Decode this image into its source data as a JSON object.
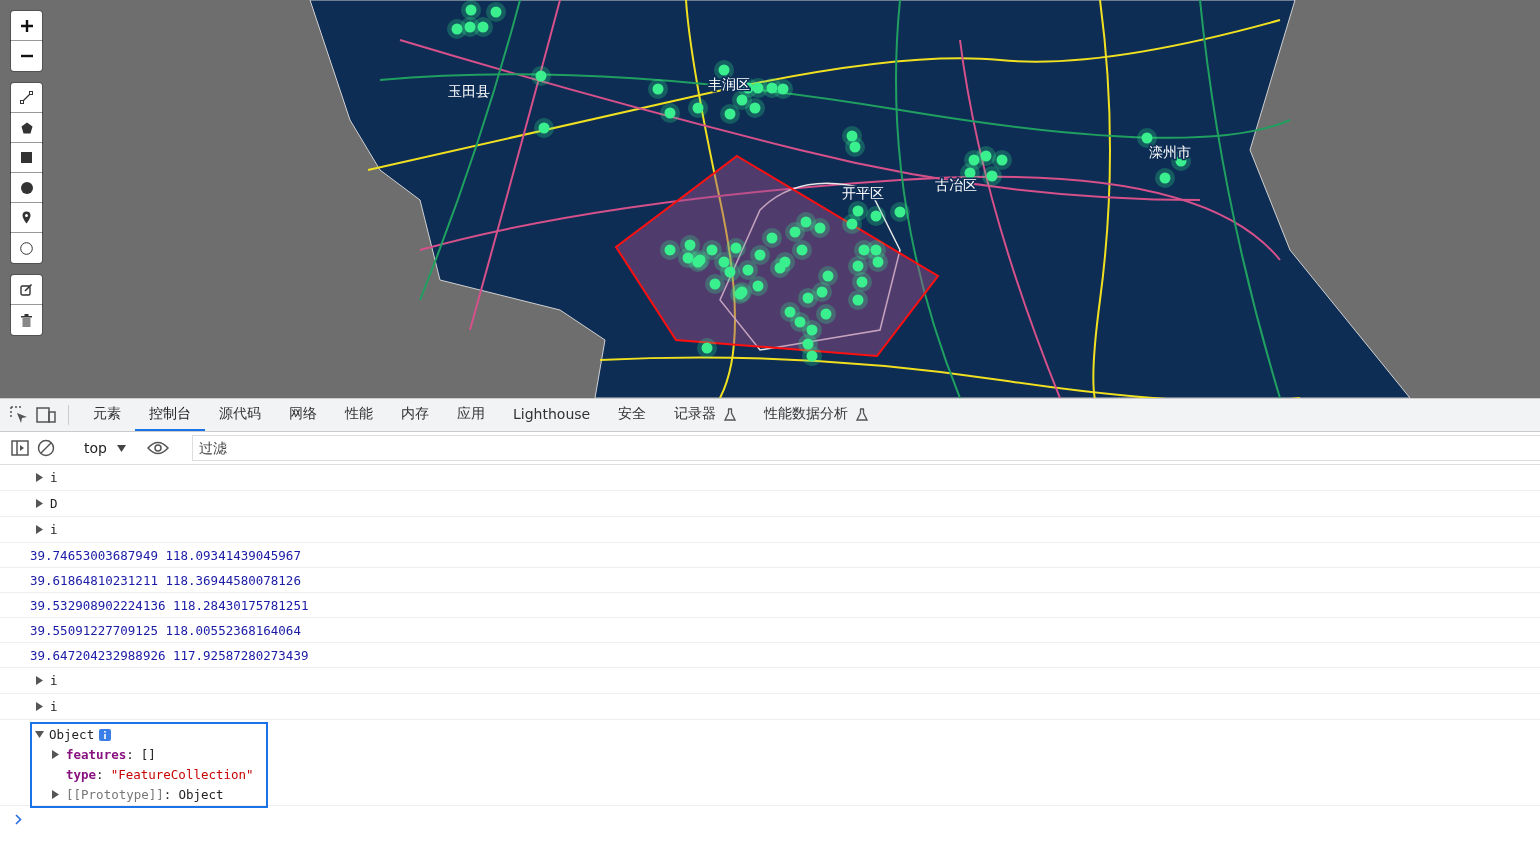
{
  "map": {
    "labels": [
      {
        "text": "玉田县"
      },
      {
        "text": "丰润区"
      },
      {
        "text": "开平区"
      },
      {
        "text": "古冶区"
      },
      {
        "text": "滦州市"
      }
    ],
    "tools": [
      {
        "kind": "zoom-in"
      },
      {
        "kind": "zoom-out"
      },
      {
        "kind": "line"
      },
      {
        "kind": "polygon"
      },
      {
        "kind": "rectangle"
      },
      {
        "kind": "circle-filled"
      },
      {
        "kind": "marker"
      },
      {
        "kind": "circle"
      },
      {
        "kind": "edit"
      },
      {
        "kind": "delete"
      }
    ]
  },
  "devtools": {
    "tabs": [
      {
        "label": "元素",
        "selected": false,
        "experimental": false
      },
      {
        "label": "控制台",
        "selected": true,
        "experimental": false
      },
      {
        "label": "源代码",
        "selected": false,
        "experimental": false
      },
      {
        "label": "网络",
        "selected": false,
        "experimental": false
      },
      {
        "label": "性能",
        "selected": false,
        "experimental": false
      },
      {
        "label": "内存",
        "selected": false,
        "experimental": false
      },
      {
        "label": "应用",
        "selected": false,
        "experimental": false
      },
      {
        "label": "Lighthouse",
        "selected": false,
        "experimental": false
      },
      {
        "label": "安全",
        "selected": false,
        "experimental": false
      },
      {
        "label": "记录器",
        "selected": false,
        "experimental": true
      },
      {
        "label": "性能数据分析",
        "selected": false,
        "experimental": true
      }
    ],
    "context": "top",
    "filter_placeholder": "过滤",
    "console": [
      {
        "kind": "collapsed",
        "text": "i"
      },
      {
        "kind": "collapsed",
        "text": "D"
      },
      {
        "kind": "collapsed",
        "text": "i"
      },
      {
        "kind": "log",
        "text": "39.74653003687949 118.09341439045967"
      },
      {
        "kind": "log",
        "text": "39.61864810231211 118.36944580078126"
      },
      {
        "kind": "log",
        "text": "39.532908902224136 118.28430175781251"
      },
      {
        "kind": "log",
        "text": "39.55091227709125 118.00552368164064"
      },
      {
        "kind": "log",
        "text": "39.647204232988926 117.92587280273439"
      },
      {
        "kind": "collapsed",
        "text": "i"
      },
      {
        "kind": "collapsed",
        "text": "i"
      },
      {
        "kind": "object",
        "text": "Object",
        "props": [
          {
            "kind": "expandable",
            "key": "features",
            "sep": ":",
            "value": "[]"
          },
          {
            "kind": "string",
            "key": "type",
            "sep": ":",
            "value": "\"FeatureCollection\""
          },
          {
            "kind": "proto",
            "key": "[[Prototype]]",
            "sep": ":",
            "value": "Object"
          }
        ]
      }
    ]
  }
}
